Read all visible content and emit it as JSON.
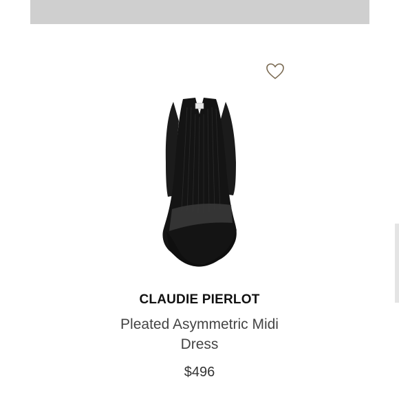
{
  "product": {
    "brand": "CLAUDIE PIERLOT",
    "name": "Pleated Asymmetric Midi Dress",
    "price": "$496",
    "wishlist_icon": "heart-icon",
    "image_subject": "black-pleated-dress"
  },
  "colors": {
    "banner": "#cfcfcf",
    "heart": "#7a6a52",
    "dress": "#141414"
  }
}
